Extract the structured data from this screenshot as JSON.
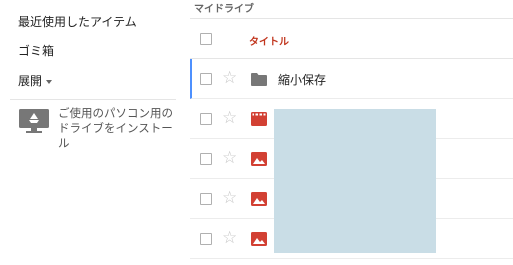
{
  "sidebar": {
    "recent_label": "最近使用したアイテム",
    "trash_label": "ゴミ箱",
    "expand_label": "展開",
    "install_text": "ご使用のパソコン用のドライブをインストール"
  },
  "main": {
    "breadcrumb": "マイドライブ",
    "column_title": "タイトル",
    "rows": [
      {
        "type": "folder",
        "name": "縮小保存"
      },
      {
        "type": "video",
        "name": ""
      },
      {
        "type": "image",
        "name": ""
      },
      {
        "type": "image",
        "name": ""
      },
      {
        "type": "image",
        "name": ""
      }
    ]
  },
  "colors": {
    "accent_red": "#c1351d",
    "icon_red": "#d24033",
    "folder_gray": "#777777",
    "selection_blue": "#4d90fe",
    "redaction": "#c9dde6"
  }
}
